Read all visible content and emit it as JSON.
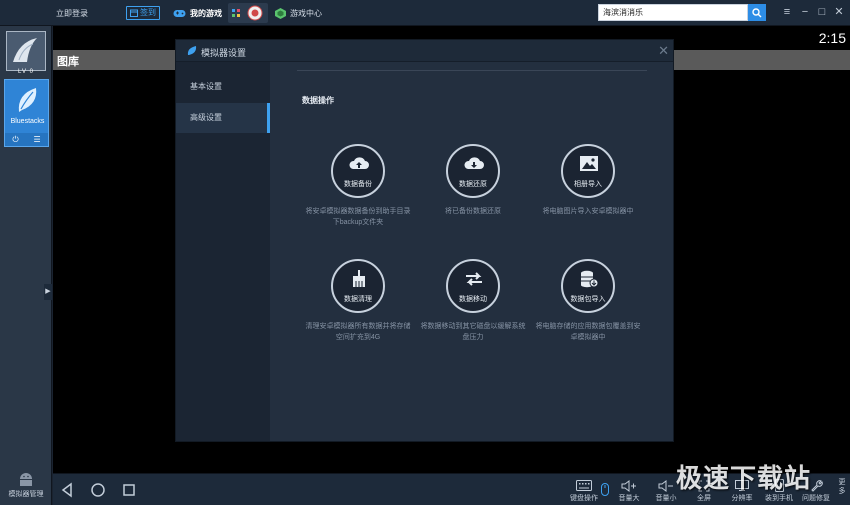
{
  "topbar": {
    "login": "立即登录",
    "signin": "签到",
    "tab_mygames": "我的游戏",
    "tab_gamecenter": "游戏中心",
    "search_value": "海滨消消乐",
    "icons": [
      "search-icon",
      "menu-icon",
      "minimize-icon",
      "maximize-icon",
      "close-icon"
    ]
  },
  "sidebar": {
    "level": "LV 0",
    "app_name": "Bluestacks",
    "manager": "模拟器管理"
  },
  "screen": {
    "clock": "2:15",
    "gallery_title": "图库"
  },
  "dialog": {
    "title": "模拟器设置",
    "nav": [
      "基本设置",
      "高级设置"
    ],
    "section_title": "数据操作",
    "operations": [
      {
        "label": "数据备份",
        "desc": "将安卓模拟器数据备份到助手目录下backup文件夹",
        "icon": "cloud-upload-icon"
      },
      {
        "label": "数据还原",
        "desc": "将已备份数据还原",
        "icon": "cloud-download-icon"
      },
      {
        "label": "相册导入",
        "desc": "将电脑图片导入安卓模拟器中",
        "icon": "image-icon"
      },
      {
        "label": "数据清理",
        "desc": "清理安卓模拟器所有数据并将存储空间扩充到4G",
        "icon": "broom-icon"
      },
      {
        "label": "数据移动",
        "desc": "将数据移动到其它磁盘以缓解系统盘压力",
        "icon": "swap-arrows-icon"
      },
      {
        "label": "数据包导入",
        "desc": "将电脑存储的应用数据包覆盖到安卓模拟器中",
        "icon": "database-import-icon"
      }
    ]
  },
  "bottombar": {
    "tools": [
      "键盘操作",
      "音量大",
      "音量小",
      "全屏",
      "分辨率",
      "装到手机",
      "问题修复"
    ],
    "more": "更多"
  },
  "watermark": "极速下载站",
  "colors": {
    "accent": "#3ea1f0",
    "tile": "#2f84d6",
    "dialog_bg": "#232f3f"
  }
}
